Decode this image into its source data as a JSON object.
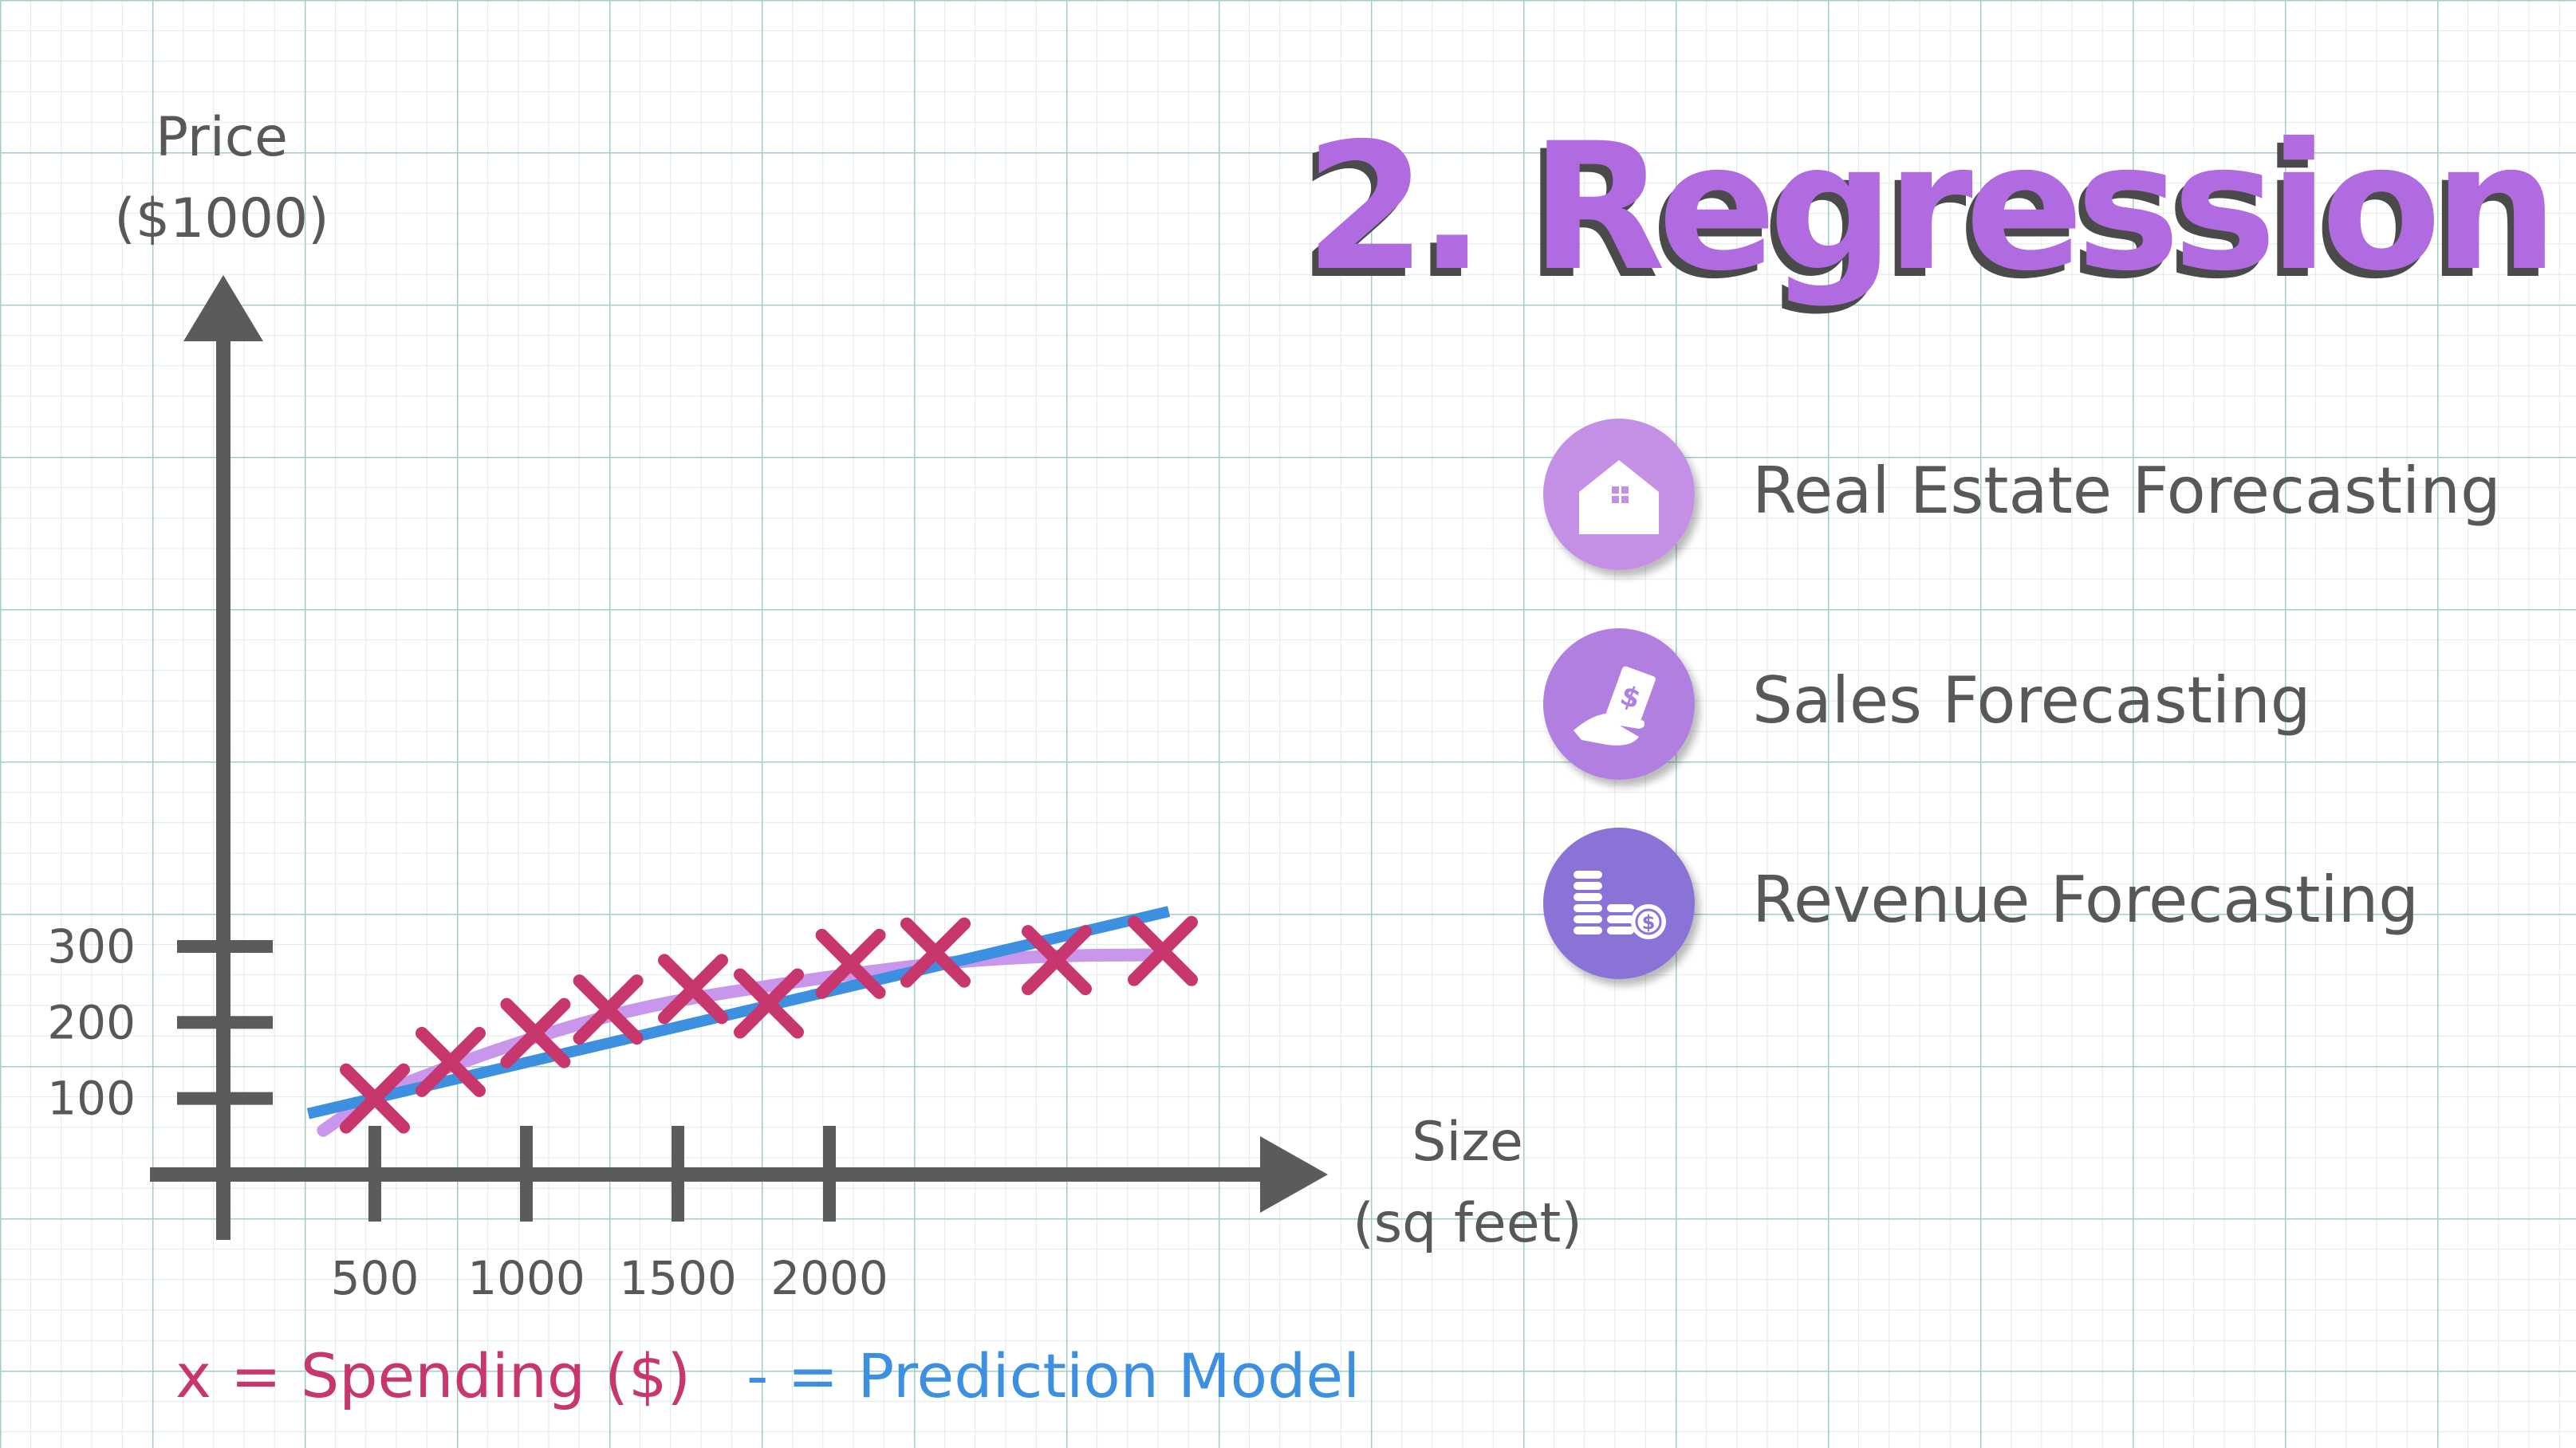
{
  "title": "2. Regression",
  "use_cases": [
    {
      "label": "Real Estate Forecasting",
      "icon": "house-icon",
      "color": "#c490e6"
    },
    {
      "label": "Sales Forecasting",
      "icon": "money-hand-icon",
      "color": "#b07fe0"
    },
    {
      "label": "Revenue Forecasting",
      "icon": "coins-stack-icon",
      "color": "#8a72d6"
    }
  ],
  "chart_data": {
    "type": "scatter",
    "ylabel": "Price\n($1000)",
    "xlabel": "Size\n(sq feet)",
    "x_ticks": [
      500,
      1000,
      1500,
      2000
    ],
    "y_ticks": [
      100,
      200,
      300
    ],
    "xlim": [
      0,
      3200
    ],
    "ylim": [
      0,
      320
    ],
    "grid": true,
    "series": [
      {
        "name": "x = Spending ($)",
        "marker": "x",
        "color": "#c8366e",
        "points": [
          [
            500,
            100
          ],
          [
            750,
            148
          ],
          [
            1030,
            186
          ],
          [
            1270,
            217
          ],
          [
            1550,
            244
          ],
          [
            1800,
            225
          ],
          [
            2070,
            277
          ],
          [
            2350,
            292
          ],
          [
            2750,
            282
          ],
          [
            3100,
            294
          ]
        ]
      },
      {
        "name": "- = Prediction Model",
        "style": "line",
        "color": "#3d8fe0",
        "points": [
          [
            280,
            80
          ],
          [
            3120,
            346
          ]
        ]
      },
      {
        "style": "curve",
        "color": "#c897ec",
        "points": [
          [
            330,
            58
          ],
          [
            500,
            105
          ],
          [
            800,
            150
          ],
          [
            1100,
            190
          ],
          [
            1400,
            222
          ],
          [
            1700,
            242
          ],
          [
            2050,
            263
          ],
          [
            2400,
            280
          ],
          [
            2750,
            288
          ],
          [
            3080,
            289
          ]
        ]
      }
    ],
    "legend": {
      "placement": "bottom-left",
      "items": [
        {
          "text": "x = Spending ($)",
          "color": "#c8366e"
        },
        {
          "text": "- = Prediction Model",
          "color": "#3d8fe0"
        }
      ]
    }
  }
}
